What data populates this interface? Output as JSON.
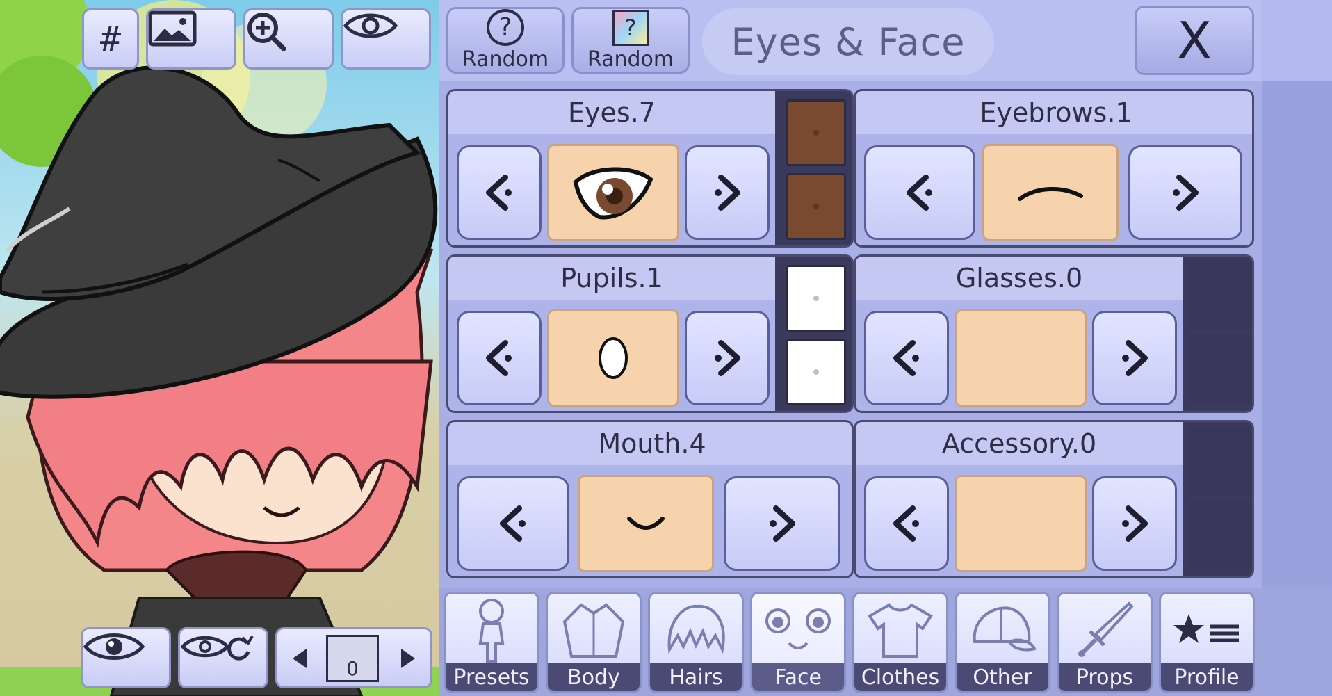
{
  "toolbar_top": {
    "grid_label": "#"
  },
  "header": {
    "random_pose_label": "Random",
    "random_color_label": "Random",
    "random_color_glyph": "?",
    "random_pose_glyph": "?",
    "title": "Eyes & Face",
    "close_label": "X"
  },
  "features": [
    {
      "label": "Eyes.7",
      "colors": [
        "#7a4a30",
        "#7a4a30"
      ]
    },
    {
      "label": "Eyebrows.1",
      "colors": []
    },
    {
      "label": "Pupils.1",
      "colors": [
        "#ffffff",
        "#ffffff"
      ]
    },
    {
      "label": "Glasses.0",
      "colors": [
        "#39385a",
        "#39385a"
      ]
    },
    {
      "label": "Mouth.4",
      "colors": []
    },
    {
      "label": "Accessory.0",
      "colors": [
        "#39385a",
        "#39385a"
      ]
    }
  ],
  "bottom_controls": {
    "layer_value": "0"
  },
  "tabs": [
    {
      "label": "Presets",
      "icon": "doll-icon"
    },
    {
      "label": "Body",
      "icon": "jacket-icon"
    },
    {
      "label": "Hairs",
      "icon": "hair-icon"
    },
    {
      "label": "Face",
      "icon": "face-icon",
      "active": true
    },
    {
      "label": "Clothes",
      "icon": "tshirt-icon"
    },
    {
      "label": "Other",
      "icon": "cap-icon"
    },
    {
      "label": "Props",
      "icon": "sword-icon"
    },
    {
      "label": "Profile",
      "icon": "star-list-icon"
    }
  ],
  "colors": {
    "panel": "#a8aee6",
    "card_header": "#c4c8f2",
    "swatch_skin": "#f6d3ad",
    "tab_label_bg": "#4a4a74",
    "hair": "#f4868a",
    "hat": "#3a3a3a",
    "eye_color": "#7a4a30"
  }
}
